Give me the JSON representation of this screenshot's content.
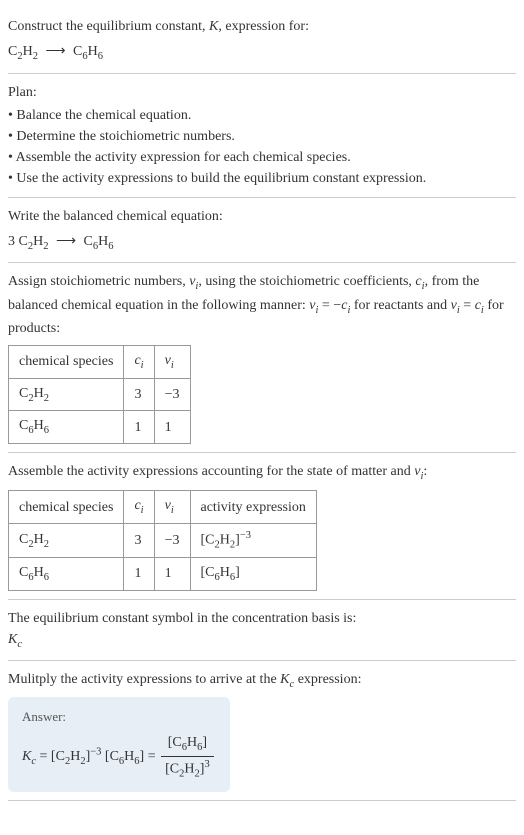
{
  "intro": {
    "text1": "Construct the equilibrium constant, ",
    "K": "K",
    "text2": ", expression for:"
  },
  "plan": {
    "label": "Plan:",
    "items": [
      "• Balance the chemical equation.",
      "• Determine the stoichiometric numbers.",
      "• Assemble the activity expression for each chemical species.",
      "• Use the activity expressions to build the equilibrium constant expression."
    ]
  },
  "balanced": {
    "label": "Write the balanced chemical equation:",
    "coeff": "3"
  },
  "assign": {
    "text1": "Assign stoichiometric numbers, ",
    "nu_i": "ν",
    "sub_i": "i",
    "text2": ", using the stoichiometric coefficients, ",
    "c_i": "c",
    "text3": ", from the balanced chemical equation in the following manner: ",
    "eq1_lhs": "ν",
    "eq1_eq": " = −",
    "eq1_rhs": "c",
    "text4": " for reactants and ",
    "eq2_eq": " = ",
    "text5": " for products:"
  },
  "table1": {
    "headers": {
      "species": "chemical species",
      "c": "c",
      "nu": "ν",
      "sub": "i"
    },
    "rows": [
      {
        "c": "3",
        "nu": "−3"
      },
      {
        "c": "1",
        "nu": "1"
      }
    ]
  },
  "assemble": {
    "text1": "Assemble the activity expressions accounting for the state of matter and ",
    "text2": ":"
  },
  "table2": {
    "headers": {
      "species": "chemical species",
      "c": "c",
      "nu": "ν",
      "sub": "i",
      "activity": "activity expression"
    },
    "rows": [
      {
        "c": "3",
        "nu": "−3",
        "exp": "−3"
      },
      {
        "c": "1",
        "nu": "1"
      }
    ]
  },
  "symbol": {
    "text": "The equilibrium constant symbol in the concentration basis is:",
    "K": "K",
    "sub": "c"
  },
  "multiply": {
    "text1": "Mulitply the activity expressions to arrive at the ",
    "K": "K",
    "sub": "c",
    "text2": " expression:"
  },
  "answer": {
    "label": "Answer:",
    "K": "K",
    "sub_c": "c",
    "eq": " = ",
    "exp_neg3": "−3",
    "exp_3": "3"
  },
  "species": {
    "c2h2_c": "C",
    "c2h2_2": "2",
    "c2h2_h": "H",
    "c6h6_c": "C",
    "c6h6_6": "6",
    "c6h6_h": "H"
  }
}
